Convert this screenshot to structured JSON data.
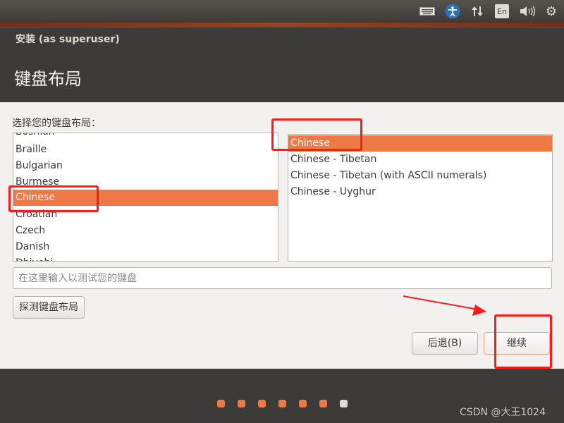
{
  "tray": {
    "icons": [
      "keyboard-icon",
      "accessibility-icon",
      "network-icon",
      "language-indicator",
      "volume-icon",
      "power-gear-icon"
    ],
    "language": "En"
  },
  "window": {
    "title": "安装 (as superuser)",
    "page_title": "键盘布局"
  },
  "main": {
    "prompt": "选择您的键盘布局：",
    "layouts": [
      "Bosnian",
      "Braille",
      "Bulgarian",
      "Burmese",
      "Chinese",
      "Croatian",
      "Czech",
      "Danish",
      "Dhivehi"
    ],
    "selected_layout": "Chinese",
    "variants": [
      "Chinese",
      "Chinese - Tibetan",
      "Chinese - Tibetan (with ASCII numerals)",
      "Chinese - Uyghur"
    ],
    "selected_variant": "Chinese",
    "test_input_placeholder": "在这里输入以测试您的键盘",
    "detect_button": "探测键盘布局",
    "back_button": "后退(B)",
    "continue_button": "继续"
  },
  "progress": {
    "completed_steps": 6,
    "total_steps": 7,
    "done_color": "#f07746",
    "pending_color": "#dddddd"
  },
  "watermark": "CSDN @大王1024",
  "annotation_color": "#ff1a1a"
}
